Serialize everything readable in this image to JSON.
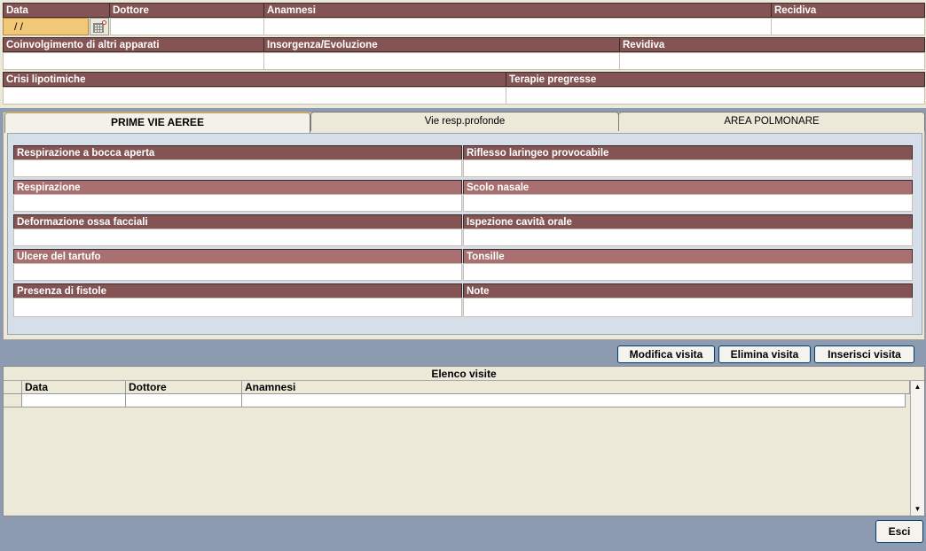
{
  "header": {
    "data_label": "Data",
    "data_value": " /  /",
    "dottore_label": "Dottore",
    "anamnesi_label": "Anamnesi",
    "recidiva_label": "Recidiva",
    "coinvolgimento_label": "Coinvolgimento di altri apparati",
    "insorgenza_label": "Insorgenza/Evoluzione",
    "revidiva_label": "Revidiva",
    "crisi_label": "Crisi lipotimiche",
    "terapie_label": "Terapie pregresse"
  },
  "tabs": [
    {
      "label": "PRIME VIE AEREE",
      "active": true
    },
    {
      "label": "Vie resp.profonde",
      "active": false
    },
    {
      "label": "AREA POLMONARE",
      "active": false
    }
  ],
  "panel_fields": {
    "left": [
      "Respirazione a bocca aperta",
      "Respirazione",
      "Deformazione ossa facciali",
      "Ulcere del tartufo",
      "Presenza di fistole"
    ],
    "right": [
      "Riflesso laringeo provocabile",
      "Scolo nasale",
      "Ispezione cavità orale",
      "Tonsille",
      "Note"
    ]
  },
  "actions": {
    "modifica": "Modifica visita",
    "elimina": "Elimina visita",
    "inserisci": "Inserisci visita",
    "esci": "Esci"
  },
  "grid": {
    "title": "Elenco visite",
    "columns": [
      "Data",
      "Dottore",
      "Anamnesi"
    ]
  },
  "colors": {
    "header_dark": "#845454",
    "header_light": "#a87070",
    "background": "#8c9bb0",
    "panel": "#ece9d8",
    "inner_panel": "#d6dfe9",
    "date_field": "#f0c878"
  }
}
